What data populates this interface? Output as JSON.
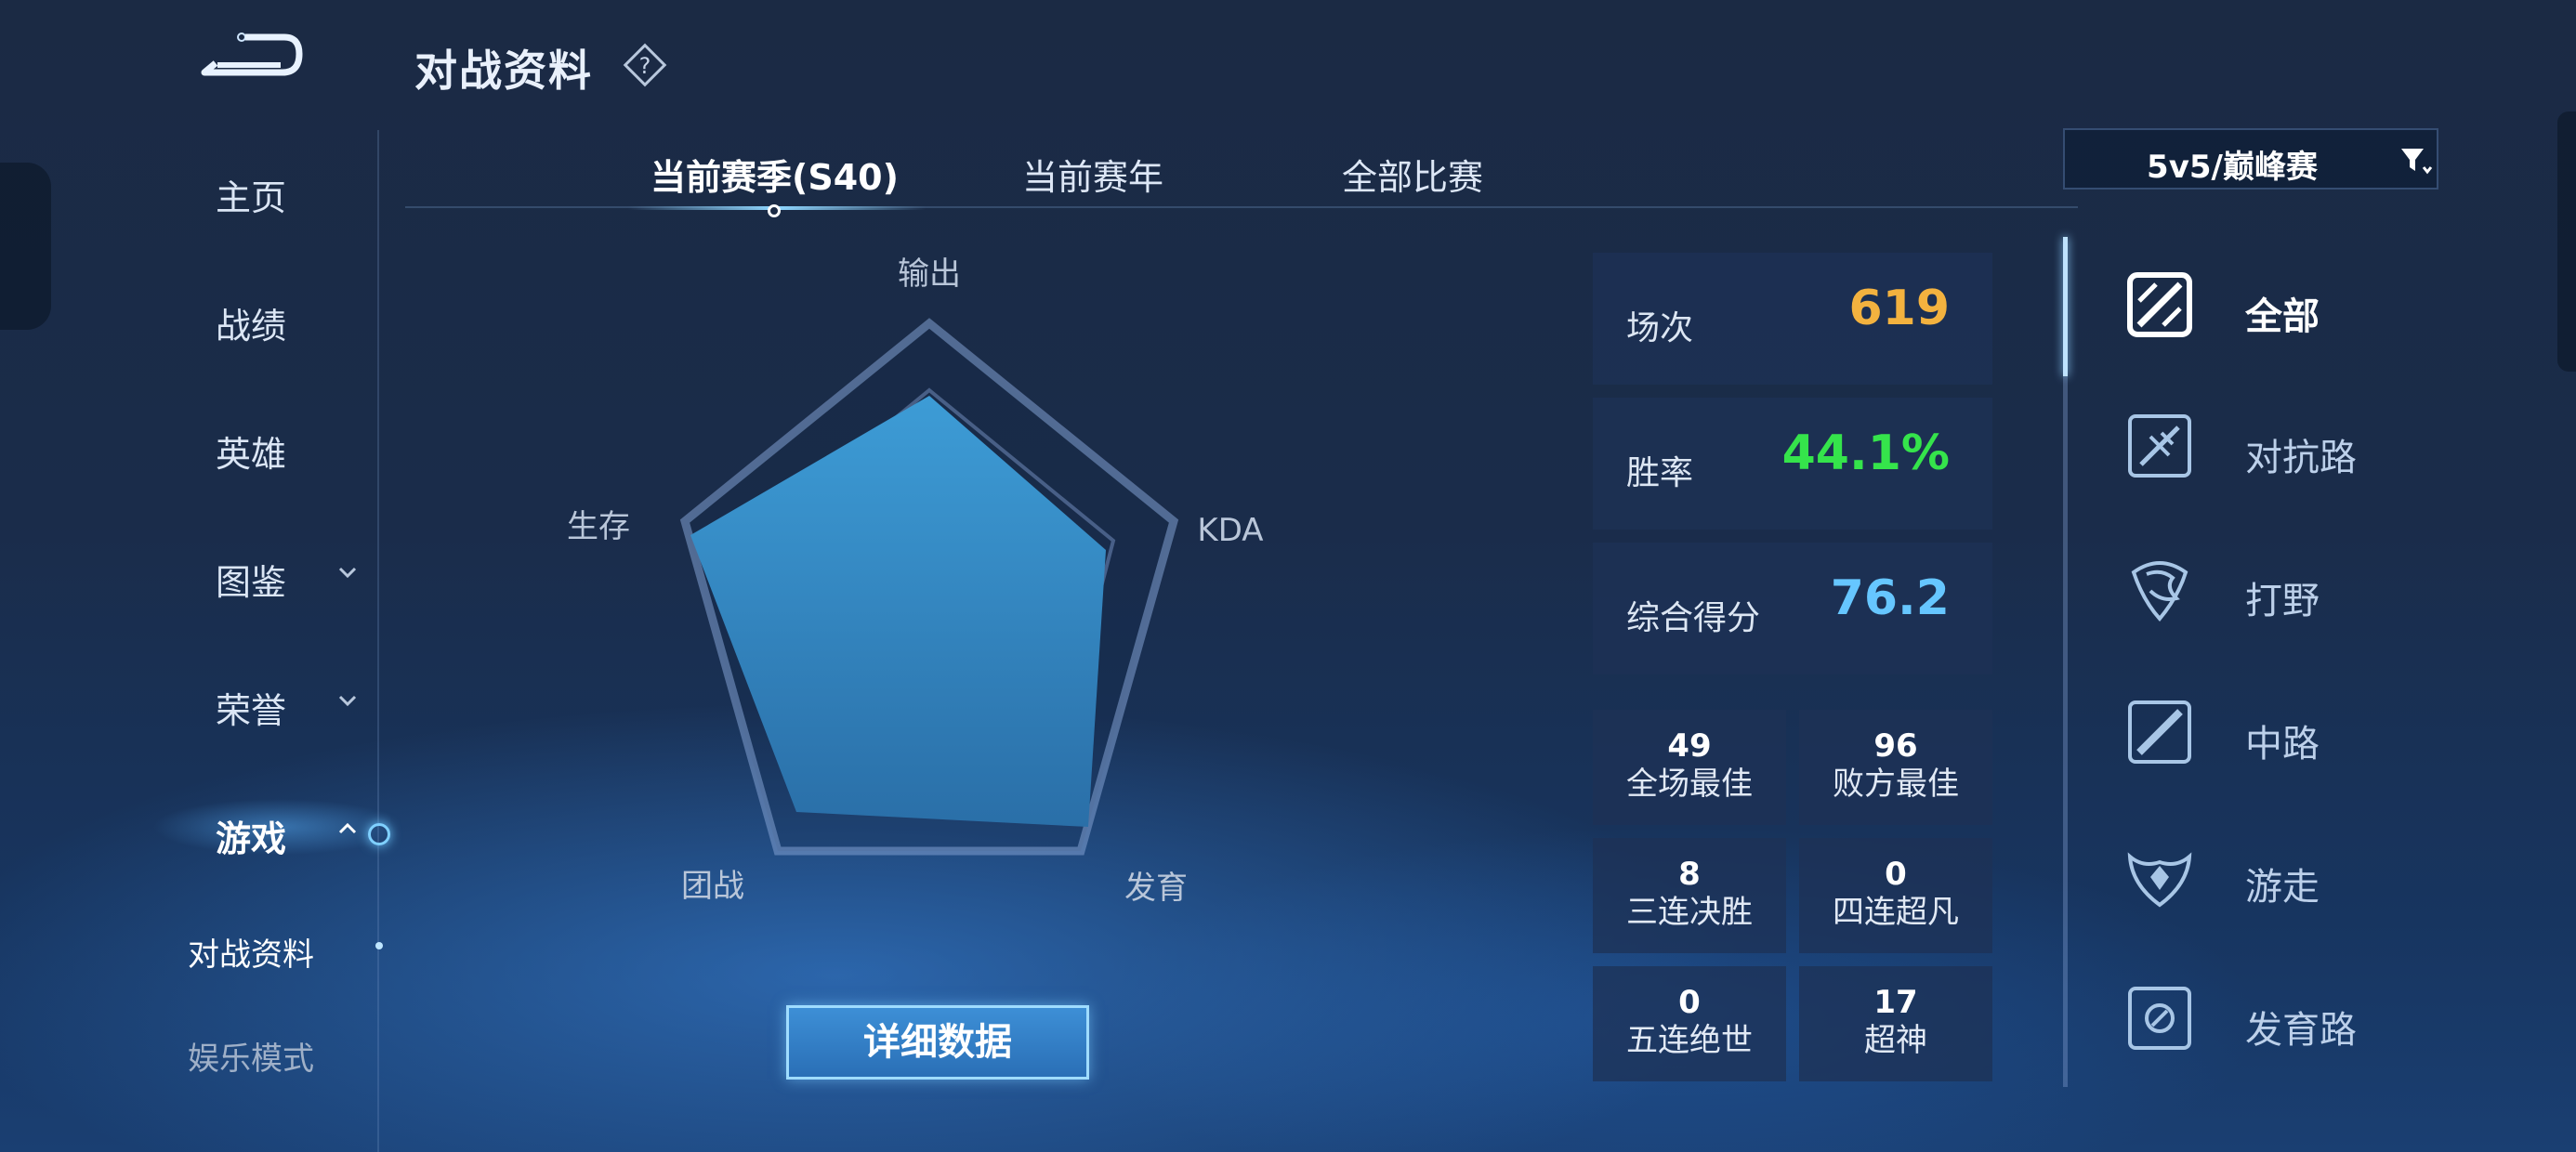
{
  "header": {
    "title": "对战资料",
    "help_icon": "diamond-question-icon",
    "back_icon": "back-arrow-icon"
  },
  "nav": {
    "items": [
      {
        "label": "主页"
      },
      {
        "label": "战绩"
      },
      {
        "label": "英雄"
      },
      {
        "label": "图鉴",
        "expandable": true
      },
      {
        "label": "荣誉",
        "expandable": true
      },
      {
        "label": "游戏",
        "expandable": true,
        "active": true
      }
    ],
    "sub_items": [
      {
        "label": "对战资料",
        "current": true
      },
      {
        "label": "娱乐模式"
      }
    ]
  },
  "tabs": [
    {
      "label": "当前赛季(S40)",
      "active": true
    },
    {
      "label": "当前赛年"
    },
    {
      "label": "全部比赛"
    }
  ],
  "mode_select": {
    "value": "5v5/巅峰赛",
    "icon": "filter-icon"
  },
  "radar": {
    "axes": [
      "输出",
      "KDA",
      "发育",
      "团战",
      "生存"
    ],
    "fill_color": "#3a93cf"
  },
  "detail_button": {
    "label": "详细数据"
  },
  "stats": {
    "matches": {
      "label": "场次",
      "value": "619",
      "color": "#f3b23f"
    },
    "winrate": {
      "label": "胜率",
      "value": "44.1%",
      "color": "#35e44b"
    },
    "score": {
      "label": "综合得分",
      "value": "76.2",
      "color": "#66c6ff"
    }
  },
  "achievements": [
    {
      "value": "49",
      "label": "全场最佳"
    },
    {
      "value": "96",
      "label": "败方最佳"
    },
    {
      "value": "8",
      "label": "三连决胜"
    },
    {
      "value": "0",
      "label": "四连超凡"
    },
    {
      "value": "0",
      "label": "五连绝世"
    },
    {
      "value": "17",
      "label": "超神"
    }
  ],
  "roles": [
    {
      "label": "全部",
      "icon": "all-roles-icon",
      "active": true
    },
    {
      "label": "对抗路",
      "icon": "clash-lane-icon"
    },
    {
      "label": "打野",
      "icon": "jungle-icon"
    },
    {
      "label": "中路",
      "icon": "mid-lane-icon"
    },
    {
      "label": "游走",
      "icon": "roam-icon"
    },
    {
      "label": "发育路",
      "icon": "farm-lane-icon"
    }
  ]
}
